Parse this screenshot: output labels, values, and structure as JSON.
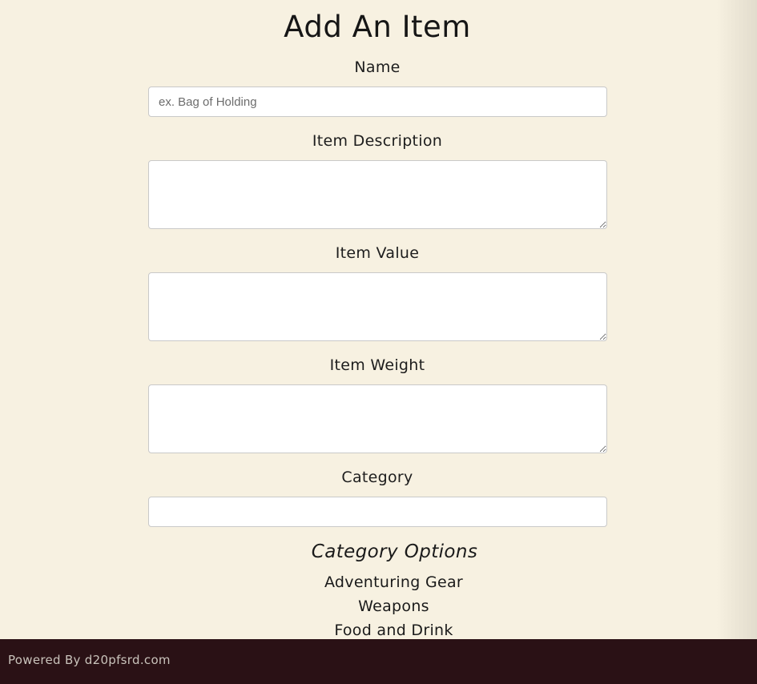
{
  "form": {
    "title": "Add An Item",
    "fields": {
      "name": {
        "label": "Name",
        "placeholder": "ex. Bag of Holding",
        "value": ""
      },
      "description": {
        "label": "Item Description",
        "value": ""
      },
      "value": {
        "label": "Item Value",
        "value": ""
      },
      "weight": {
        "label": "Item Weight",
        "value": ""
      },
      "category": {
        "label": "Category",
        "value": ""
      }
    }
  },
  "category_options": {
    "title": "Category Options",
    "items": [
      "Adventuring Gear",
      "Weapons",
      "Food and Drink"
    ]
  },
  "footer": {
    "text": "Powered By d20pfsrd.com"
  },
  "colors": {
    "background": "#f7f1e1",
    "footer_background": "#2a1115",
    "footer_text": "#c9c3bb"
  }
}
